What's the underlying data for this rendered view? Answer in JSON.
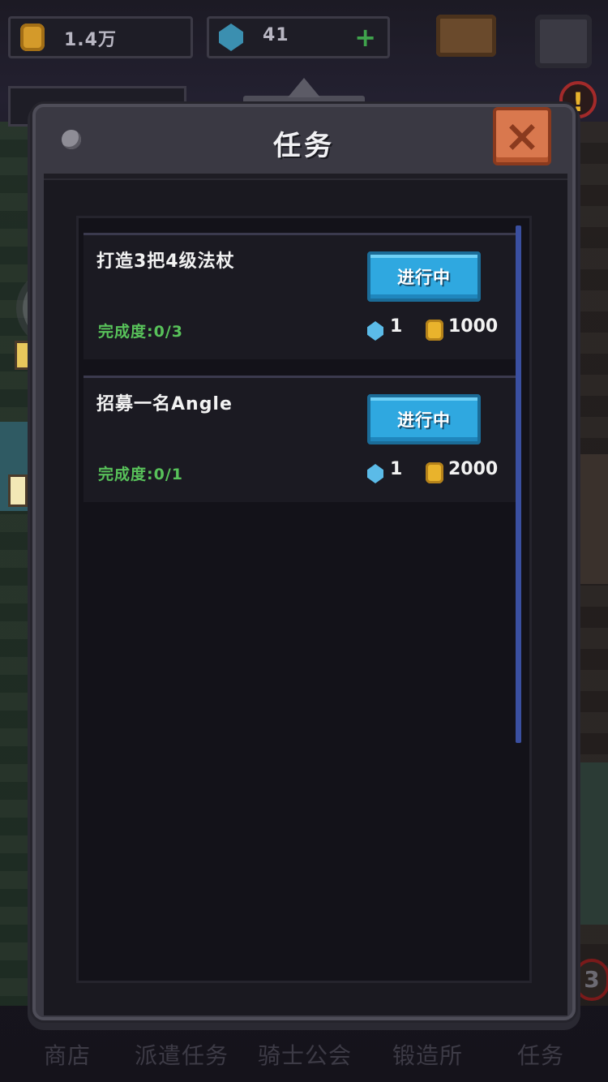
{
  "top_bar": {
    "gold": "1.4万",
    "gems": "41",
    "plus_label": "+"
  },
  "alert_label": "!",
  "modal": {
    "title": "任务",
    "close_label": "×"
  },
  "tasks": [
    {
      "title": "打造3把4级法杖",
      "progress": "完成度:0/3",
      "status_button": "进行中",
      "reward_gems": "1",
      "reward_gold": "1000"
    },
    {
      "title": "招募一名Angle",
      "progress": "完成度:0/1",
      "status_button": "进行中",
      "reward_gems": "1",
      "reward_gold": "2000"
    }
  ],
  "bottom_nav": {
    "items": [
      "商店",
      "派遣任务",
      "骑士公会",
      "锻造所",
      "任务"
    ],
    "badge": "3"
  },
  "colors": {
    "accent_button": "#2fa8e0",
    "progress_text": "#58c25a",
    "close_button": "#d9784e",
    "scrollbar": "#3a4fa0"
  }
}
